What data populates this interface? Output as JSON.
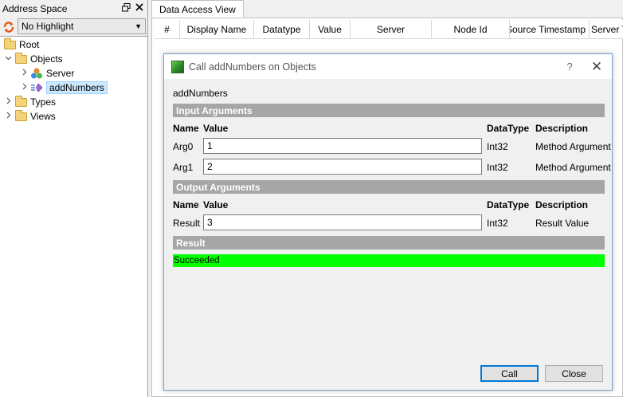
{
  "address_space": {
    "title": "Address Space",
    "float_icon": "float-icon",
    "close_icon": "close-icon",
    "highlight_combo": {
      "value": "No Highlight"
    },
    "tree": [
      {
        "label": "Root",
        "icon": "folder-icon",
        "expander": ""
      },
      {
        "label": "Objects",
        "icon": "folder-icon",
        "expander": "⌄"
      },
      {
        "label": "Server",
        "icon": "server-object-icon",
        "expander": "›"
      },
      {
        "label": "addNumbers",
        "icon": "method-icon",
        "expander": "›",
        "selected": true
      },
      {
        "label": "Types",
        "icon": "folder-icon",
        "expander": "›"
      },
      {
        "label": "Views",
        "icon": "folder-icon",
        "expander": "›"
      }
    ]
  },
  "data_access_view": {
    "tab_label": "Data Access View",
    "columns": [
      "#",
      "Display Name",
      "Datatype",
      "Value",
      "Server",
      "Node Id",
      "Source Timestamp",
      "Server T"
    ]
  },
  "dialog": {
    "title": "Call addNumbers on Objects",
    "help_label": "?",
    "close_label": "✕",
    "method_name": "addNumbers",
    "input_section": "Input Arguments",
    "output_section": "Output Arguments",
    "result_section": "Result",
    "col_name": "Name",
    "col_value": "Value",
    "col_datatype": "DataType",
    "col_description": "Description",
    "inputs": [
      {
        "name": "Arg0",
        "value": "1",
        "datatype": "Int32",
        "description": "Method Argument"
      },
      {
        "name": "Arg1",
        "value": "2",
        "datatype": "Int32",
        "description": "Method Argument"
      }
    ],
    "outputs": [
      {
        "name": "Result",
        "value": "3",
        "datatype": "Int32",
        "description": "Result Value"
      }
    ],
    "result_text": "Succeeded",
    "result_color": "#00ff00",
    "call_button": "Call",
    "close_button": "Close"
  }
}
